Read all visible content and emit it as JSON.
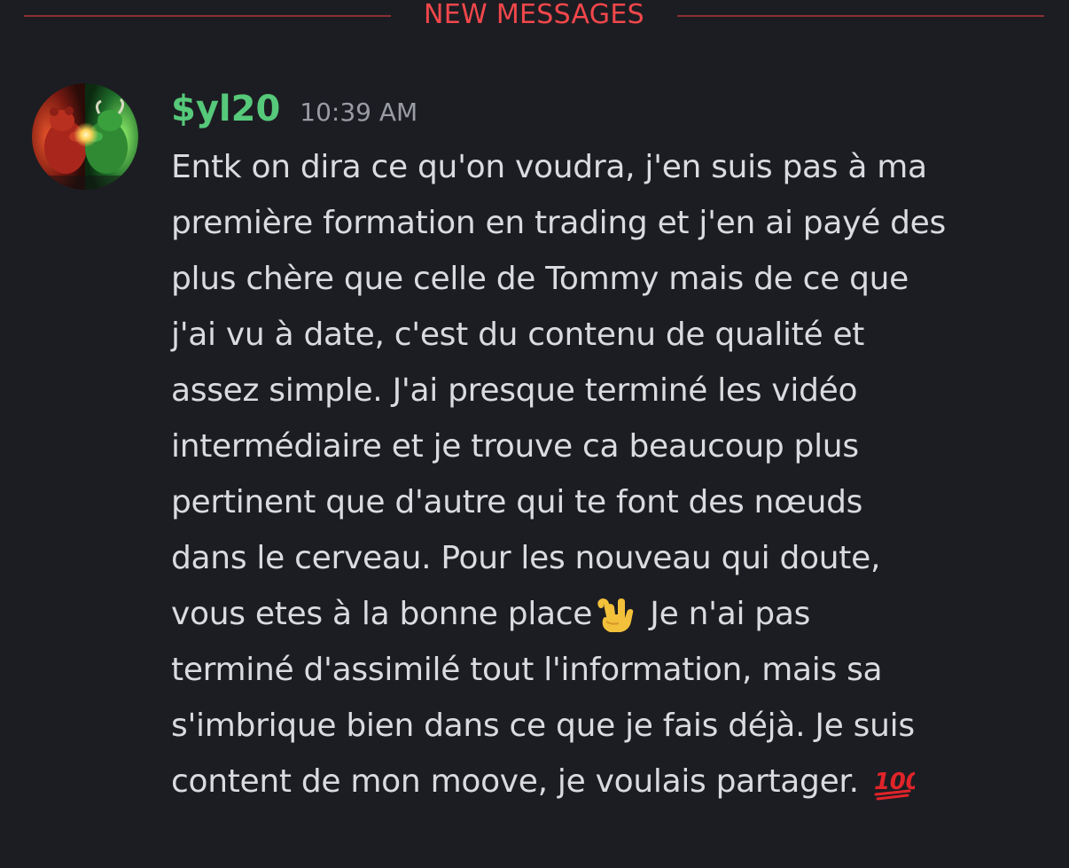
{
  "divider": {
    "label": "NEW MESSAGES"
  },
  "message": {
    "username": "$yl20",
    "timestamp": "10:39 AM",
    "avatar_icon": "bull-vs-bear-avatar",
    "lines": [
      "Entk on dira ce qu'on voudra, j'en suis pas à ma",
      "première formation en trading et j'en ai payé des",
      "plus chère que celle de Tommy mais de ce que",
      "j'ai vu à date, c'est du contenu de qualité et",
      "assez simple. J'ai presque terminé les vidéo",
      "intermédiaire et je trouve ca beaucoup plus",
      "pertinent que d'autre qui te font des nœuds",
      "dans le cerveau.  Pour les nouveau qui doute,"
    ],
    "line9_before_emoji": "vous etes à la bonne place",
    "line9_emoji": "love-you-gesture-emoji",
    "line9_after_emoji": " Je n'ai pas",
    "lines_after": [
      "terminé d'assimilé tout l'information, mais sa",
      "s'imbrique bien dans ce que je fais déjà.  Je suis"
    ],
    "last_line_text": "content de mon moove, je voulais partager. ",
    "last_line_emoji": "hundred-points-emoji"
  },
  "colors": {
    "background": "#1c1d22",
    "new_messages": "#f2474b",
    "username": "#56c97a",
    "timestamp": "#9a9ca3",
    "text": "#dadbde"
  }
}
